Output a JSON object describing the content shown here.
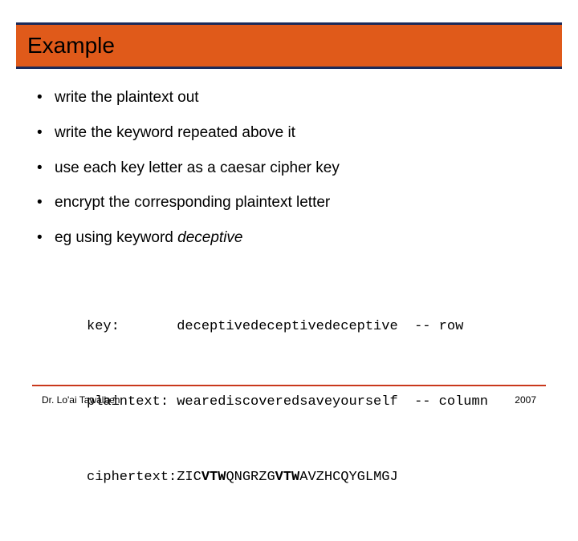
{
  "title": "Example",
  "bullets": [
    "write the plaintext out",
    "write the keyword repeated above it",
    "use each key letter as a caesar cipher key",
    "encrypt the corresponding plaintext letter"
  ],
  "bullet5_prefix": "eg using keyword ",
  "bullet5_keyword": "deceptive",
  "mono": {
    "key_label": "key:       ",
    "key_value": "deceptivedeceptivedeceptive",
    "key_note": "  -- row",
    "plain_label": "plaintext: ",
    "plain_value": "wearediscoveredsaveyourself",
    "plain_note": "  -- column",
    "cipher_label": "ciphertext:",
    "cipher_p1": "ZIC",
    "cipher_b1": "VTW",
    "cipher_p2": "QNGRZG",
    "cipher_b2": "VTW",
    "cipher_p3": "AVZHCQYGLMGJ"
  },
  "footer": {
    "author": "Dr. Lo'ai Tawalbeh",
    "year": "2007"
  }
}
